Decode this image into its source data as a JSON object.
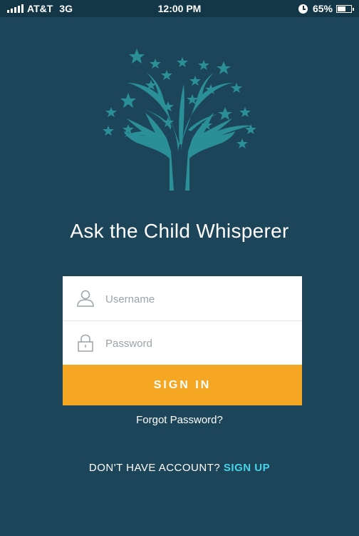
{
  "status_bar": {
    "carrier": "AT&T",
    "network": "3G",
    "time": "12:00 PM",
    "battery": "65%",
    "icons": [
      "signal-bars-icon",
      "alarm-clock-icon",
      "battery-icon"
    ]
  },
  "logo": {
    "icon": "tree-with-stars-and-hands-icon"
  },
  "title": "Ask the Child Whisperer",
  "form": {
    "username_placeholder": "Username",
    "password_placeholder": "Password",
    "signin_label": "SIGN IN"
  },
  "forgot_password": "Forgot Password?",
  "signup": {
    "prompt": "DON'T HAVE ACCOUNT?",
    "link": "SIGN UP"
  },
  "colors": {
    "background": "#1c4559",
    "status_bar": "#133746",
    "logo": "#2b8f98",
    "signin_button": "#f5a623",
    "signup_link": "#47d3e8"
  }
}
